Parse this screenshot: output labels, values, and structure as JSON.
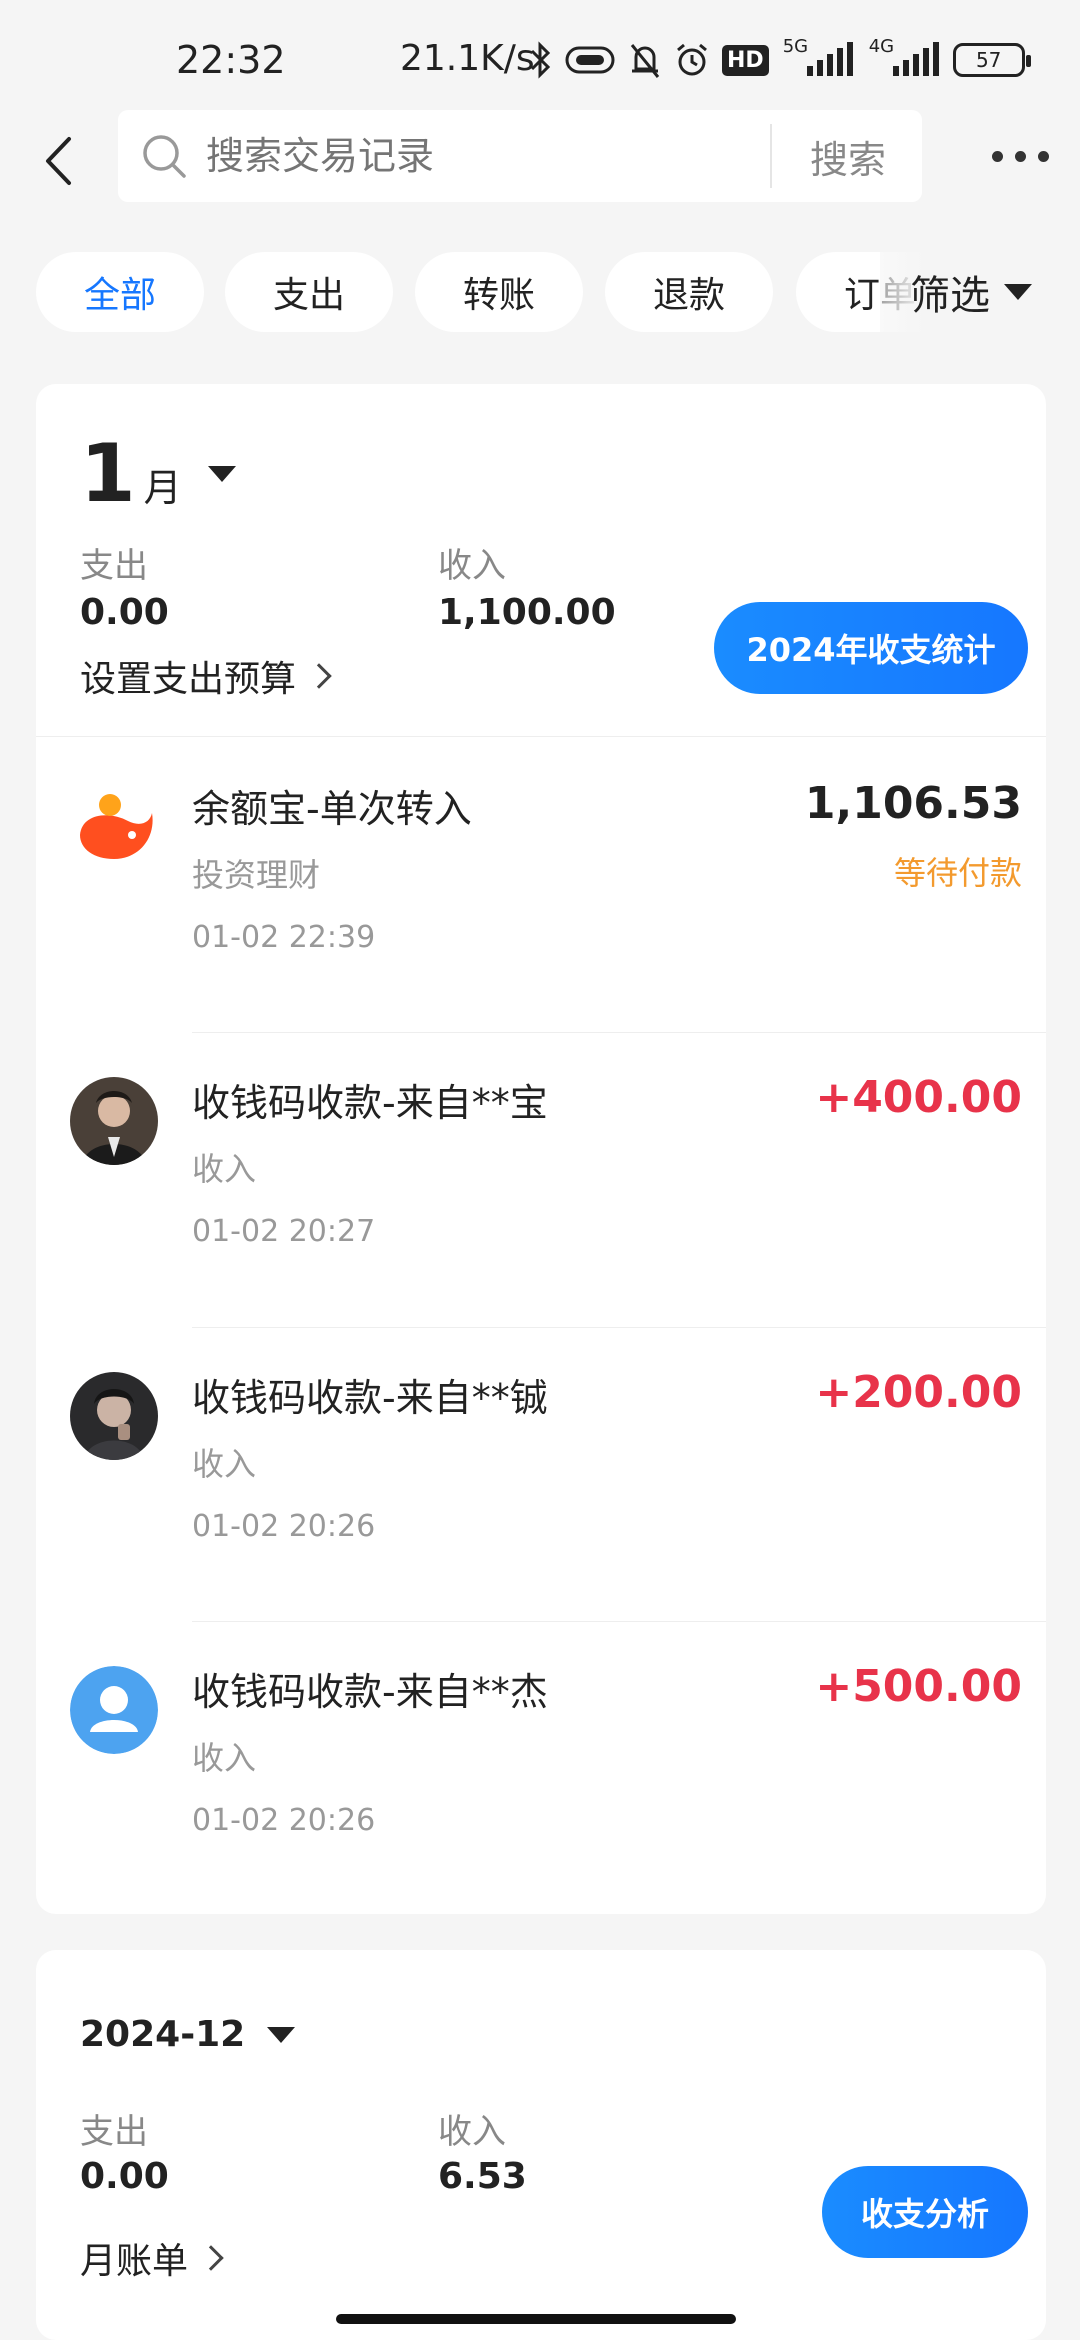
{
  "status_bar": {
    "time": "22:32",
    "net_speed": "21.1K/s",
    "hd_label": "HD",
    "net1": "5G",
    "net2": "4G",
    "battery": "57"
  },
  "search": {
    "placeholder": "搜索交易记录",
    "button_label": "搜索"
  },
  "filters": {
    "chips": [
      "全部",
      "支出",
      "转账",
      "退款",
      "订单"
    ],
    "active_index": 0,
    "filter_label": "筛选",
    "accent_color": "#1677ff"
  },
  "month_card": {
    "month_num": "1",
    "month_unit": "月",
    "expense_label": "支出",
    "expense_value": "0.00",
    "income_label": "收入",
    "income_value": "1,100.00",
    "budget_label": "设置支出预算",
    "stats_button": "2024年收支统计"
  },
  "transactions": [
    {
      "title": "余额宝-单次转入",
      "category": "投资理财",
      "time": "01-02 22:39",
      "amount": "1,106.53",
      "status": "等待付款",
      "avatar": "yuebao-icon"
    },
    {
      "title": "收钱码收款-来自**宝",
      "category": "收入",
      "time": "01-02 20:27",
      "amount": "+400.00",
      "avatar": "user-photo"
    },
    {
      "title": "收钱码收款-来自**铖",
      "category": "收入",
      "time": "01-02 20:26",
      "amount": "+200.00",
      "avatar": "user-photo"
    },
    {
      "title": "收钱码收款-来自**杰",
      "category": "收入",
      "time": "01-02 20:26",
      "amount": "+500.00",
      "avatar": "default-user-icon"
    }
  ],
  "dec_card": {
    "month_label": "2024-12",
    "expense_label": "支出",
    "expense_value": "0.00",
    "income_label": "收入",
    "income_value": "6.53",
    "bill_label": "月账单",
    "analysis_button": "收支分析"
  },
  "colors": {
    "income": "#e8334a",
    "pending": "#f39a2e",
    "primary": "#1677ff"
  }
}
